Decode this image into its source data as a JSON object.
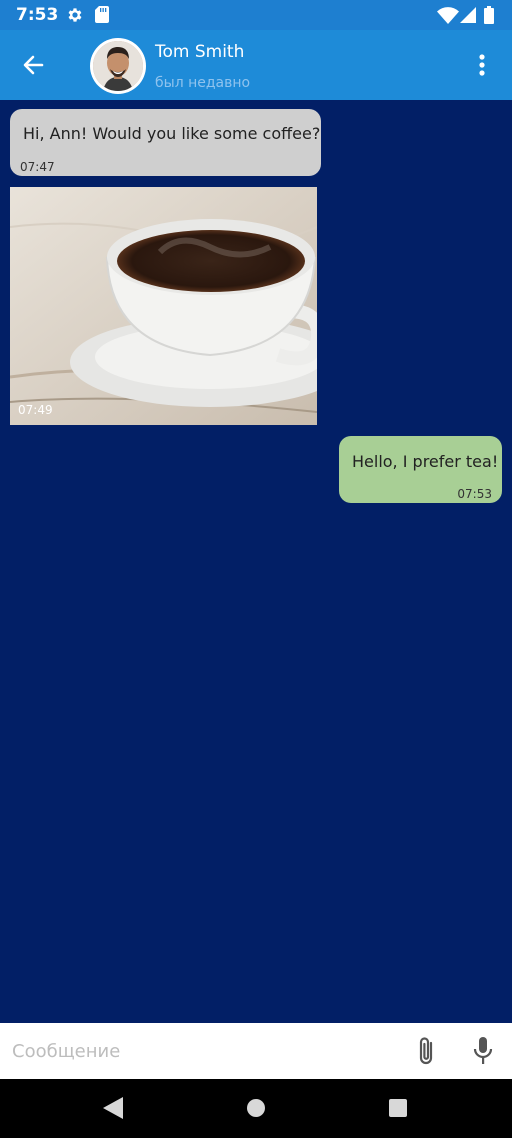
{
  "status_bar": {
    "time": "7:53",
    "icons": [
      "settings-icon",
      "sd-card-icon",
      "wifi-icon",
      "signal-icon",
      "battery-icon"
    ]
  },
  "header": {
    "contact_name": "Tom Smith",
    "contact_status": "был недавно",
    "icons": [
      "back-arrow-icon",
      "more-vertical-icon"
    ]
  },
  "messages": [
    {
      "direction": "incoming",
      "type": "text",
      "text": "Hi, Ann! Would you like some coffee?",
      "time": "07:47"
    },
    {
      "direction": "incoming",
      "type": "image",
      "image_subject": "coffee-cup-photo",
      "time": "07:49"
    },
    {
      "direction": "outgoing",
      "type": "text",
      "text": "Hello, I prefer tea!",
      "time": "07:53"
    }
  ],
  "composer": {
    "placeholder": "Сообщение",
    "icons": [
      "paperclip-icon",
      "microphone-icon"
    ]
  },
  "colors": {
    "status_bar": "#1E7FD0",
    "app_bar": "#1E8BD8",
    "chat_background": "#021F66",
    "incoming_bubble": "#CFCFCF",
    "outgoing_bubble": "#A8CF95"
  }
}
